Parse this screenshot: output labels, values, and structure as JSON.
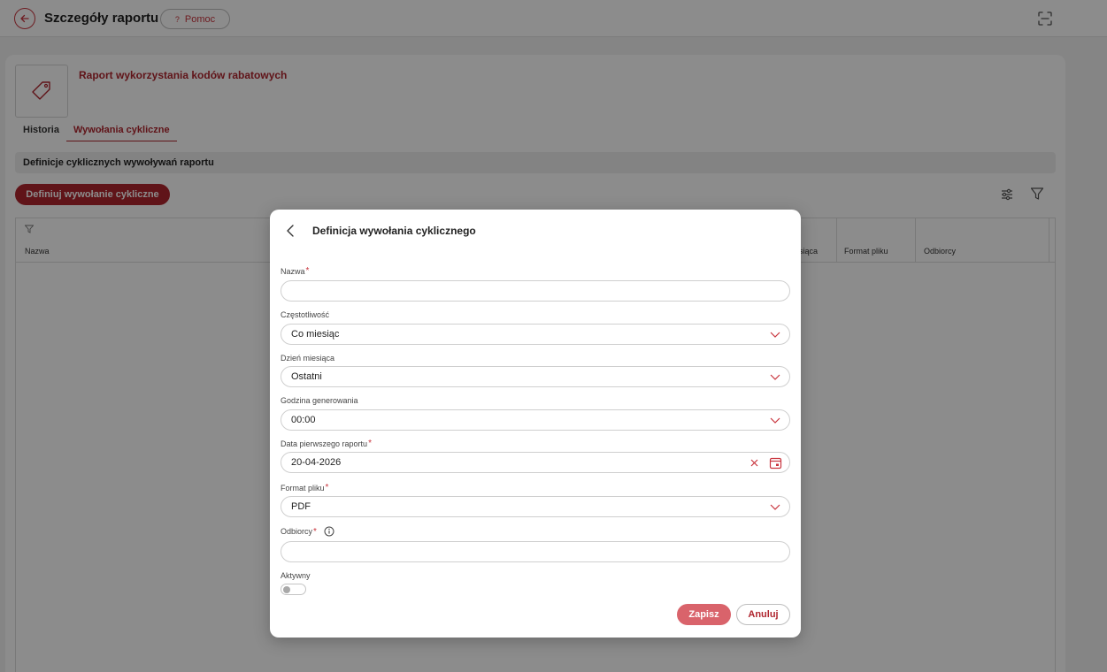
{
  "header": {
    "title": "Szczegóły raportu",
    "help_label": "Pomoc",
    "help_glyph": "?"
  },
  "report": {
    "title": "Raport wykorzystania kodów rabatowych",
    "icon": "tag-icon"
  },
  "tabs": [
    {
      "label": "Historia",
      "active": false
    },
    {
      "label": "Wywołania cykliczne",
      "active": true
    }
  ],
  "section": {
    "title": "Definicje cyklicznych wywoływań raportu"
  },
  "toolbar": {
    "define_label": "Definiuj wywołanie cykliczne"
  },
  "table": {
    "columns": [
      "Nazwa",
      "esiąca",
      "Format pliku",
      "Odbiorcy"
    ]
  },
  "modal": {
    "title": "Definicja wywołania cyklicznego",
    "fields": {
      "name": {
        "label": "Nazwa",
        "required_mark": "*",
        "value": ""
      },
      "frequency": {
        "label": "Częstotliwość",
        "value": "Co miesiąc"
      },
      "day_of_month": {
        "label": "Dzień miesiąca",
        "value": "Ostatni"
      },
      "hour": {
        "label": "Godzina generowania",
        "value": "00:00"
      },
      "first_date": {
        "label": "Data pierwszego raportu",
        "required_mark": "*",
        "value": "20-04-2026"
      },
      "file_format": {
        "label": "Format pliku",
        "required_mark": "*",
        "value": "PDF"
      },
      "recipients": {
        "label": "Odbiorcy",
        "required_mark": "*",
        "value": ""
      },
      "active": {
        "label": "Aktywny",
        "on": false
      }
    },
    "save_label": "Zapisz",
    "cancel_label": "Anuluj"
  },
  "colors": {
    "accent": "#b0262f",
    "accent_light": "#d9636b",
    "overlay": "rgba(0,0,0,0.45)"
  }
}
